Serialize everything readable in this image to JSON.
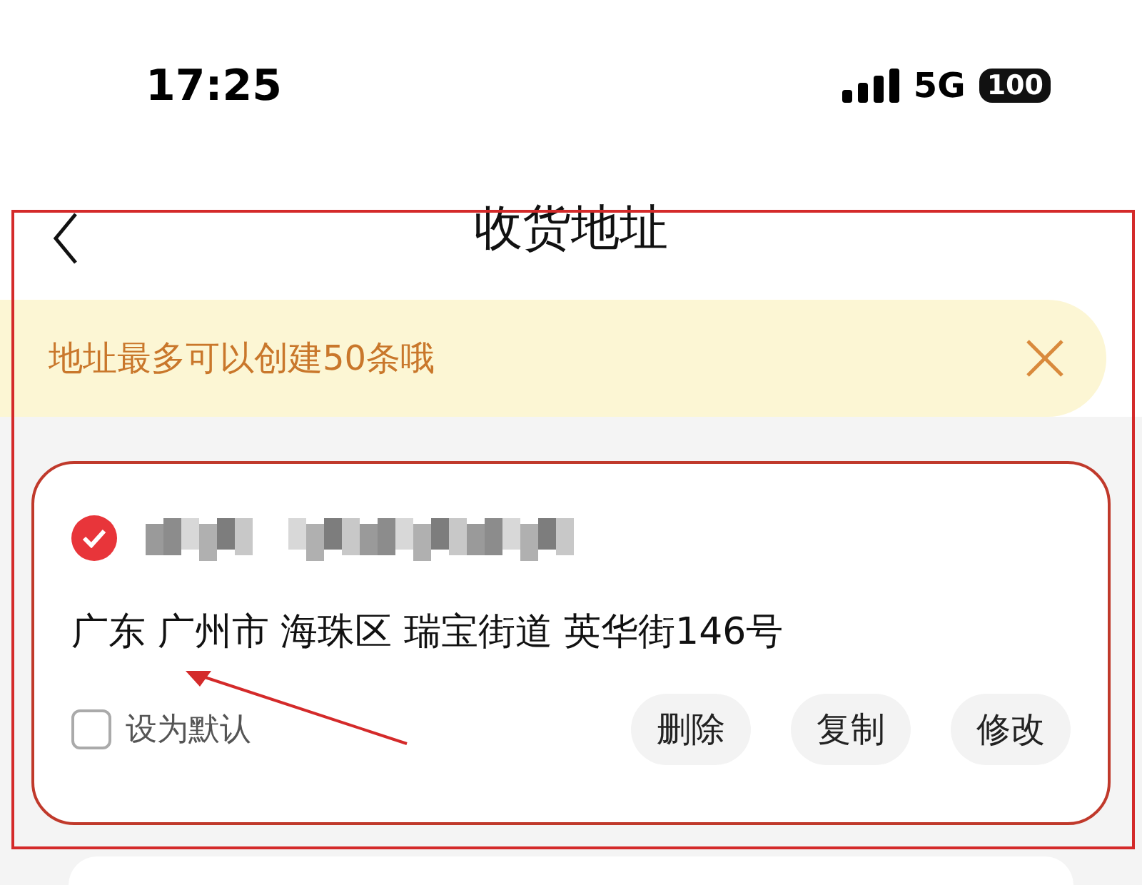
{
  "status_bar": {
    "time": "17:25",
    "network": "5G",
    "battery": "100"
  },
  "header": {
    "title": "收货地址"
  },
  "notice": {
    "text": "地址最多可以创建50条哦"
  },
  "addresses": [
    {
      "selected": true,
      "highlighted": true,
      "address": "广东 广州市 海珠区 瑞宝街道 英华街146号",
      "default": false,
      "default_label": "设为默认",
      "actions": [
        "删除",
        "复制",
        "修改"
      ]
    }
  ],
  "annotations": {
    "frame": true,
    "arrow": true
  }
}
